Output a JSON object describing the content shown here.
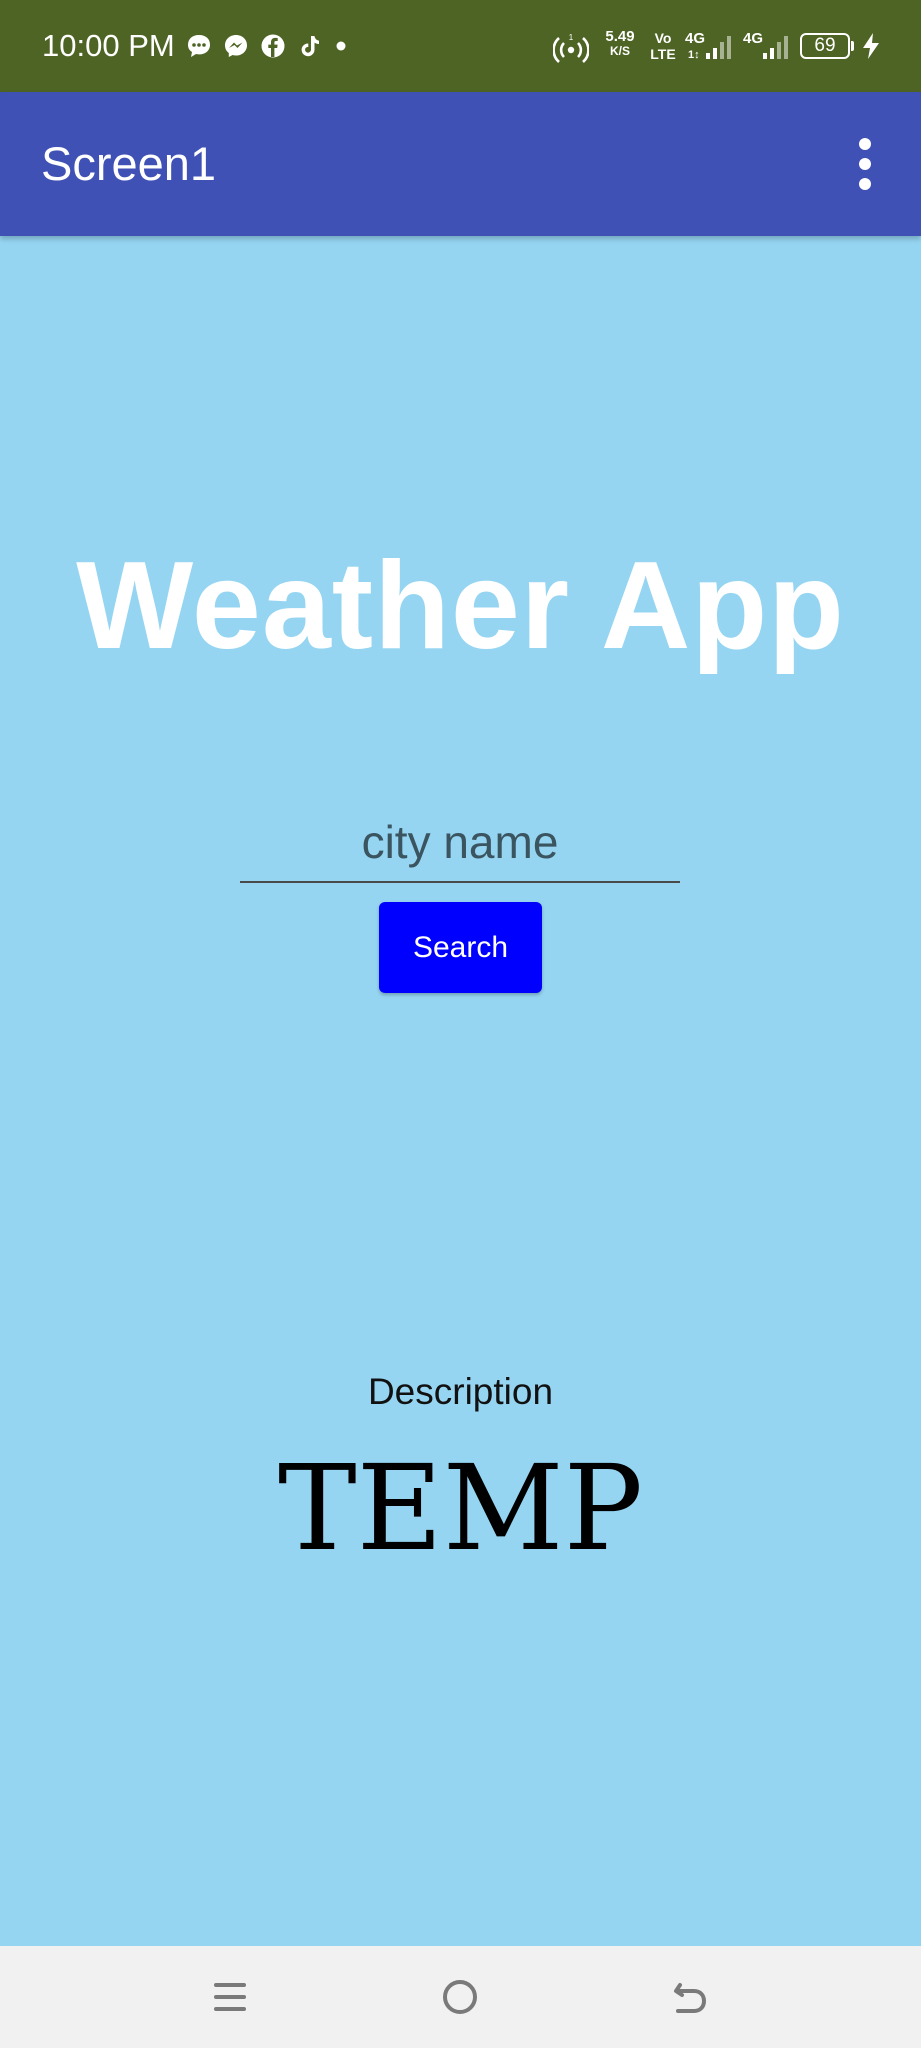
{
  "status_bar": {
    "time": "10:00 PM",
    "notification_icons": [
      "chat-bubble-icon",
      "messenger-icon",
      "facebook-icon",
      "tiktok-icon",
      "dot-icon"
    ],
    "hotspot_icon": "hotspot-icon",
    "net_speed_value": "5.49",
    "net_speed_unit": "K/S",
    "volte_top": "Vo",
    "volte_bottom": "LTE",
    "sim1_label": "4G",
    "sim2_label": "4G",
    "battery_level": "69",
    "charging_icon": "charging-bolt-icon"
  },
  "app_bar": {
    "title": "Screen1",
    "menu_icon": "overflow-menu-icon"
  },
  "main": {
    "heading": "Weather App",
    "city_input": {
      "placeholder": "city name",
      "value": ""
    },
    "search_button_label": "Search",
    "description_label": "Description",
    "temp_label": "TEMP"
  },
  "nav_bar": {
    "icons": [
      "menu-lines-icon",
      "home-circle-icon",
      "back-arrow-icon"
    ]
  },
  "colors": {
    "status_bar": "#4E6424",
    "app_bar": "#3F51B5",
    "background": "#95D5F2",
    "button": "#0000FF",
    "nav_bar": "#F1F1F1"
  }
}
